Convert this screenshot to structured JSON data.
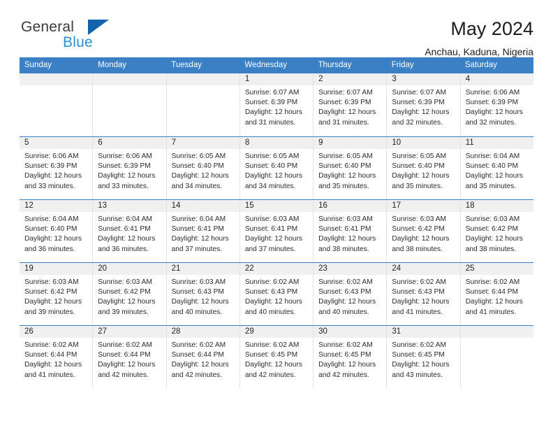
{
  "brand": {
    "name_part1": "General",
    "name_part2": "Blue",
    "accent": "#1463ad",
    "blue_text": "#2a8fd6"
  },
  "header": {
    "title": "May 2024",
    "subtitle": "Anchau, Kaduna, Nigeria"
  },
  "calendar": {
    "header_bg": "#3b7fc4",
    "daynum_bg": "#f0f0f0",
    "weekdays": [
      "Sunday",
      "Monday",
      "Tuesday",
      "Wednesday",
      "Thursday",
      "Friday",
      "Saturday"
    ],
    "weeks": [
      [
        {
          "day": "",
          "sunrise": "",
          "sunset": "",
          "daylight": ""
        },
        {
          "day": "",
          "sunrise": "",
          "sunset": "",
          "daylight": ""
        },
        {
          "day": "",
          "sunrise": "",
          "sunset": "",
          "daylight": ""
        },
        {
          "day": "1",
          "sunrise": "Sunrise: 6:07 AM",
          "sunset": "Sunset: 6:39 PM",
          "daylight": "Daylight: 12 hours and 31 minutes."
        },
        {
          "day": "2",
          "sunrise": "Sunrise: 6:07 AM",
          "sunset": "Sunset: 6:39 PM",
          "daylight": "Daylight: 12 hours and 31 minutes."
        },
        {
          "day": "3",
          "sunrise": "Sunrise: 6:07 AM",
          "sunset": "Sunset: 6:39 PM",
          "daylight": "Daylight: 12 hours and 32 minutes."
        },
        {
          "day": "4",
          "sunrise": "Sunrise: 6:06 AM",
          "sunset": "Sunset: 6:39 PM",
          "daylight": "Daylight: 12 hours and 32 minutes."
        }
      ],
      [
        {
          "day": "5",
          "sunrise": "Sunrise: 6:06 AM",
          "sunset": "Sunset: 6:39 PM",
          "daylight": "Daylight: 12 hours and 33 minutes."
        },
        {
          "day": "6",
          "sunrise": "Sunrise: 6:06 AM",
          "sunset": "Sunset: 6:39 PM",
          "daylight": "Daylight: 12 hours and 33 minutes."
        },
        {
          "day": "7",
          "sunrise": "Sunrise: 6:05 AM",
          "sunset": "Sunset: 6:40 PM",
          "daylight": "Daylight: 12 hours and 34 minutes."
        },
        {
          "day": "8",
          "sunrise": "Sunrise: 6:05 AM",
          "sunset": "Sunset: 6:40 PM",
          "daylight": "Daylight: 12 hours and 34 minutes."
        },
        {
          "day": "9",
          "sunrise": "Sunrise: 6:05 AM",
          "sunset": "Sunset: 6:40 PM",
          "daylight": "Daylight: 12 hours and 35 minutes."
        },
        {
          "day": "10",
          "sunrise": "Sunrise: 6:05 AM",
          "sunset": "Sunset: 6:40 PM",
          "daylight": "Daylight: 12 hours and 35 minutes."
        },
        {
          "day": "11",
          "sunrise": "Sunrise: 6:04 AM",
          "sunset": "Sunset: 6:40 PM",
          "daylight": "Daylight: 12 hours and 35 minutes."
        }
      ],
      [
        {
          "day": "12",
          "sunrise": "Sunrise: 6:04 AM",
          "sunset": "Sunset: 6:40 PM",
          "daylight": "Daylight: 12 hours and 36 minutes."
        },
        {
          "day": "13",
          "sunrise": "Sunrise: 6:04 AM",
          "sunset": "Sunset: 6:41 PM",
          "daylight": "Daylight: 12 hours and 36 minutes."
        },
        {
          "day": "14",
          "sunrise": "Sunrise: 6:04 AM",
          "sunset": "Sunset: 6:41 PM",
          "daylight": "Daylight: 12 hours and 37 minutes."
        },
        {
          "day": "15",
          "sunrise": "Sunrise: 6:03 AM",
          "sunset": "Sunset: 6:41 PM",
          "daylight": "Daylight: 12 hours and 37 minutes."
        },
        {
          "day": "16",
          "sunrise": "Sunrise: 6:03 AM",
          "sunset": "Sunset: 6:41 PM",
          "daylight": "Daylight: 12 hours and 38 minutes."
        },
        {
          "day": "17",
          "sunrise": "Sunrise: 6:03 AM",
          "sunset": "Sunset: 6:42 PM",
          "daylight": "Daylight: 12 hours and 38 minutes."
        },
        {
          "day": "18",
          "sunrise": "Sunrise: 6:03 AM",
          "sunset": "Sunset: 6:42 PM",
          "daylight": "Daylight: 12 hours and 38 minutes."
        }
      ],
      [
        {
          "day": "19",
          "sunrise": "Sunrise: 6:03 AM",
          "sunset": "Sunset: 6:42 PM",
          "daylight": "Daylight: 12 hours and 39 minutes."
        },
        {
          "day": "20",
          "sunrise": "Sunrise: 6:03 AM",
          "sunset": "Sunset: 6:42 PM",
          "daylight": "Daylight: 12 hours and 39 minutes."
        },
        {
          "day": "21",
          "sunrise": "Sunrise: 6:03 AM",
          "sunset": "Sunset: 6:43 PM",
          "daylight": "Daylight: 12 hours and 40 minutes."
        },
        {
          "day": "22",
          "sunrise": "Sunrise: 6:02 AM",
          "sunset": "Sunset: 6:43 PM",
          "daylight": "Daylight: 12 hours and 40 minutes."
        },
        {
          "day": "23",
          "sunrise": "Sunrise: 6:02 AM",
          "sunset": "Sunset: 6:43 PM",
          "daylight": "Daylight: 12 hours and 40 minutes."
        },
        {
          "day": "24",
          "sunrise": "Sunrise: 6:02 AM",
          "sunset": "Sunset: 6:43 PM",
          "daylight": "Daylight: 12 hours and 41 minutes."
        },
        {
          "day": "25",
          "sunrise": "Sunrise: 6:02 AM",
          "sunset": "Sunset: 6:44 PM",
          "daylight": "Daylight: 12 hours and 41 minutes."
        }
      ],
      [
        {
          "day": "26",
          "sunrise": "Sunrise: 6:02 AM",
          "sunset": "Sunset: 6:44 PM",
          "daylight": "Daylight: 12 hours and 41 minutes."
        },
        {
          "day": "27",
          "sunrise": "Sunrise: 6:02 AM",
          "sunset": "Sunset: 6:44 PM",
          "daylight": "Daylight: 12 hours and 42 minutes."
        },
        {
          "day": "28",
          "sunrise": "Sunrise: 6:02 AM",
          "sunset": "Sunset: 6:44 PM",
          "daylight": "Daylight: 12 hours and 42 minutes."
        },
        {
          "day": "29",
          "sunrise": "Sunrise: 6:02 AM",
          "sunset": "Sunset: 6:45 PM",
          "daylight": "Daylight: 12 hours and 42 minutes."
        },
        {
          "day": "30",
          "sunrise": "Sunrise: 6:02 AM",
          "sunset": "Sunset: 6:45 PM",
          "daylight": "Daylight: 12 hours and 42 minutes."
        },
        {
          "day": "31",
          "sunrise": "Sunrise: 6:02 AM",
          "sunset": "Sunset: 6:45 PM",
          "daylight": "Daylight: 12 hours and 43 minutes."
        },
        {
          "day": "",
          "sunrise": "",
          "sunset": "",
          "daylight": ""
        }
      ]
    ]
  }
}
